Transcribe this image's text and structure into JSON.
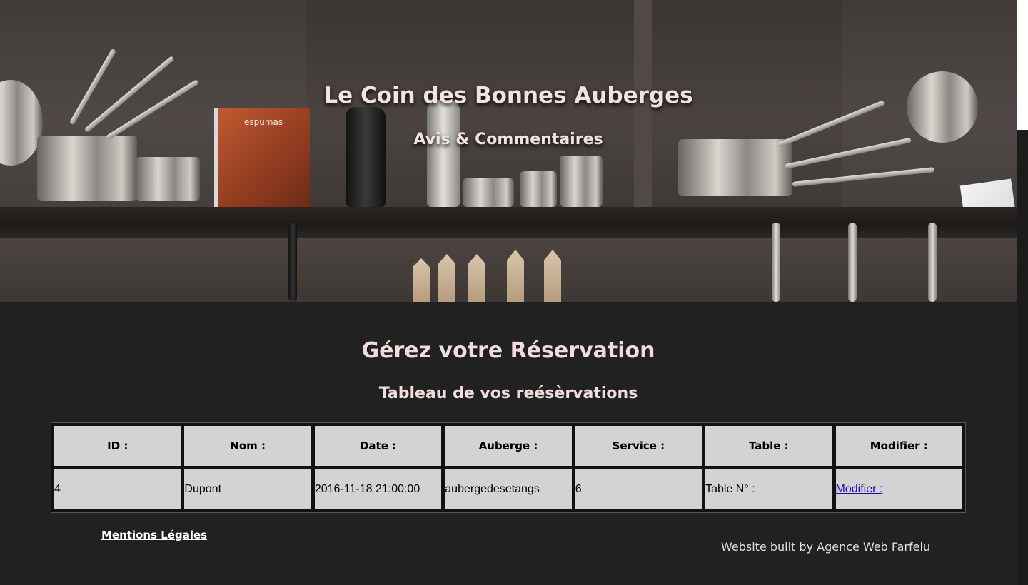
{
  "header": {
    "site_title": "Le Coin des Bonnes Auberges",
    "subtitle": "Avis & Commentaires",
    "banner_book_title": "espumas"
  },
  "main": {
    "title": "Gérez votre Réservation",
    "table_title": "Tableau de vos reésèrvations",
    "table": {
      "columns": [
        "ID :",
        "Nom :",
        "Date :",
        "Auberge :",
        "Service :",
        "Table :",
        "Modifier :"
      ],
      "rows": [
        {
          "id": "4",
          "nom": "Dupont",
          "date": "2016-11-18 21:00:00",
          "auberge": "aubergedesetangs",
          "service": "6",
          "table": "Table N° :",
          "modifier_link": "Modifier :"
        }
      ]
    }
  },
  "footer": {
    "legal_link": "Mentions Légales",
    "credit": "Website built by Agence Web Farfelu"
  },
  "colors": {
    "page_background": "#212121",
    "heading_text": "#f1dcdc",
    "table_cell": "#d3d3d3",
    "link": "#1a0dab"
  }
}
